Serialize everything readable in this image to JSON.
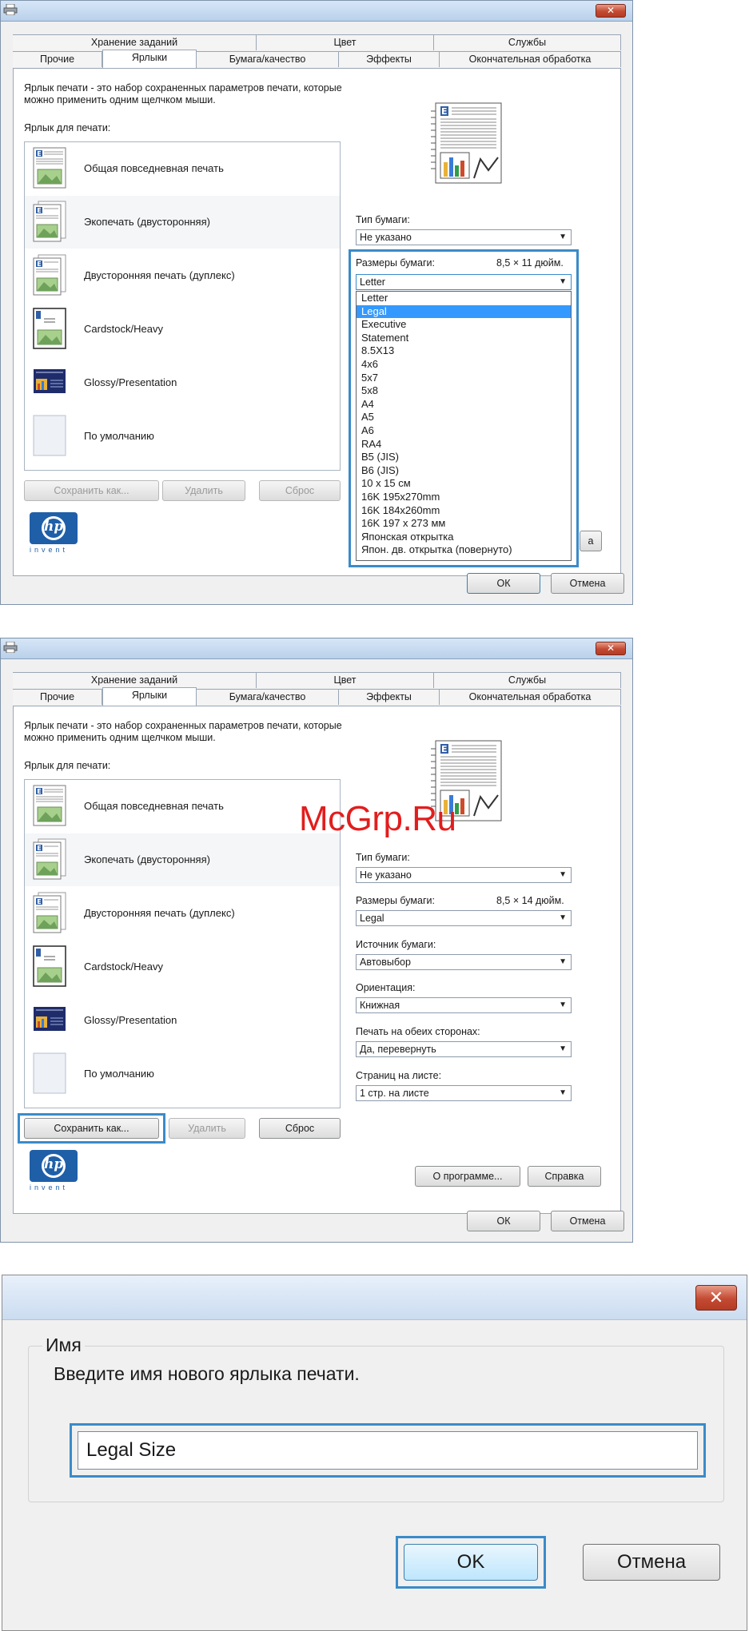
{
  "common": {
    "close_glyph": "✕",
    "tabs_row_back": [
      "Хранение заданий",
      "Цвет",
      "Службы"
    ],
    "tabs_row_front": [
      "Прочие",
      "Ярлыки",
      "Бумага/качество",
      "Эффекты",
      "Окончательная обработка"
    ],
    "description_line1": "Ярлык печати - это набор сохраненных параметров печати, которые",
    "description_line2": "можно применить одним щелчком мыши.",
    "shortcuts_label": "Ярлык для печати:",
    "shortcuts": [
      "Общая повседневная печать",
      "Экопечать (двусторонняя)",
      "Двусторонняя печать (дуплекс)",
      "Cardstock/Heavy",
      "Glossy/Presentation",
      "По умолчанию"
    ],
    "save_as_label": "Сохранить как...",
    "delete_label": "Удалить",
    "reset_label": "Сброс",
    "hp_logo_text": "hp",
    "hp_invent_text": "invent",
    "ok_label": "ОК",
    "cancel_label": "Отмена",
    "paper_type_label": "Тип бумаги:",
    "paper_type_value": "Не указано",
    "paper_size_label": "Размеры бумаги:"
  },
  "dialog1": {
    "paper_size_dims": "8,5 × 11 дюйм.",
    "paper_size_value": "Letter",
    "partial_button_text": "а",
    "dropdown_options": [
      "Letter",
      "Legal",
      "Executive",
      "Statement",
      "8.5X13",
      "4x6",
      "5x7",
      "5x8",
      "A4",
      "A5",
      "A6",
      "RA4",
      "B5 (JIS)",
      "B6 (JIS)",
      "10 x 15 см",
      "16K 195x270mm",
      "16K 184x260mm",
      "16K 197 x 273 мм",
      "Японская открытка",
      "Япон. дв. открытка (повернуто)"
    ],
    "selected_option": "Legal"
  },
  "dialog2": {
    "paper_size_dims": "8,5 × 14 дюйм.",
    "paper_size_value": "Legal",
    "paper_source_label": "Источник бумаги:",
    "paper_source_value": "Автовыбор",
    "orientation_label": "Ориентация:",
    "orientation_value": "Книжная",
    "duplex_label": "Печать на обеих сторонах:",
    "duplex_value": "Да, перевернуть",
    "pages_per_sheet_label": "Страниц на листе:",
    "pages_per_sheet_value": "1 стр. на листе",
    "about_label": "О программе...",
    "help_label": "Справка"
  },
  "watermark": "McGrp.Ru",
  "dialog3": {
    "close_glyph": "✕",
    "group_label": "Имя",
    "prompt": "Введите имя нового ярлыка печати.",
    "name_value": "Legal Size",
    "ok_label": "OK",
    "cancel_label": "Отмена"
  },
  "colors": {
    "highlight_frame": "#3a8bc8",
    "selection": "#3399ff",
    "watermark": "#e21d1d",
    "hp_blue": "#1f5fa8"
  }
}
